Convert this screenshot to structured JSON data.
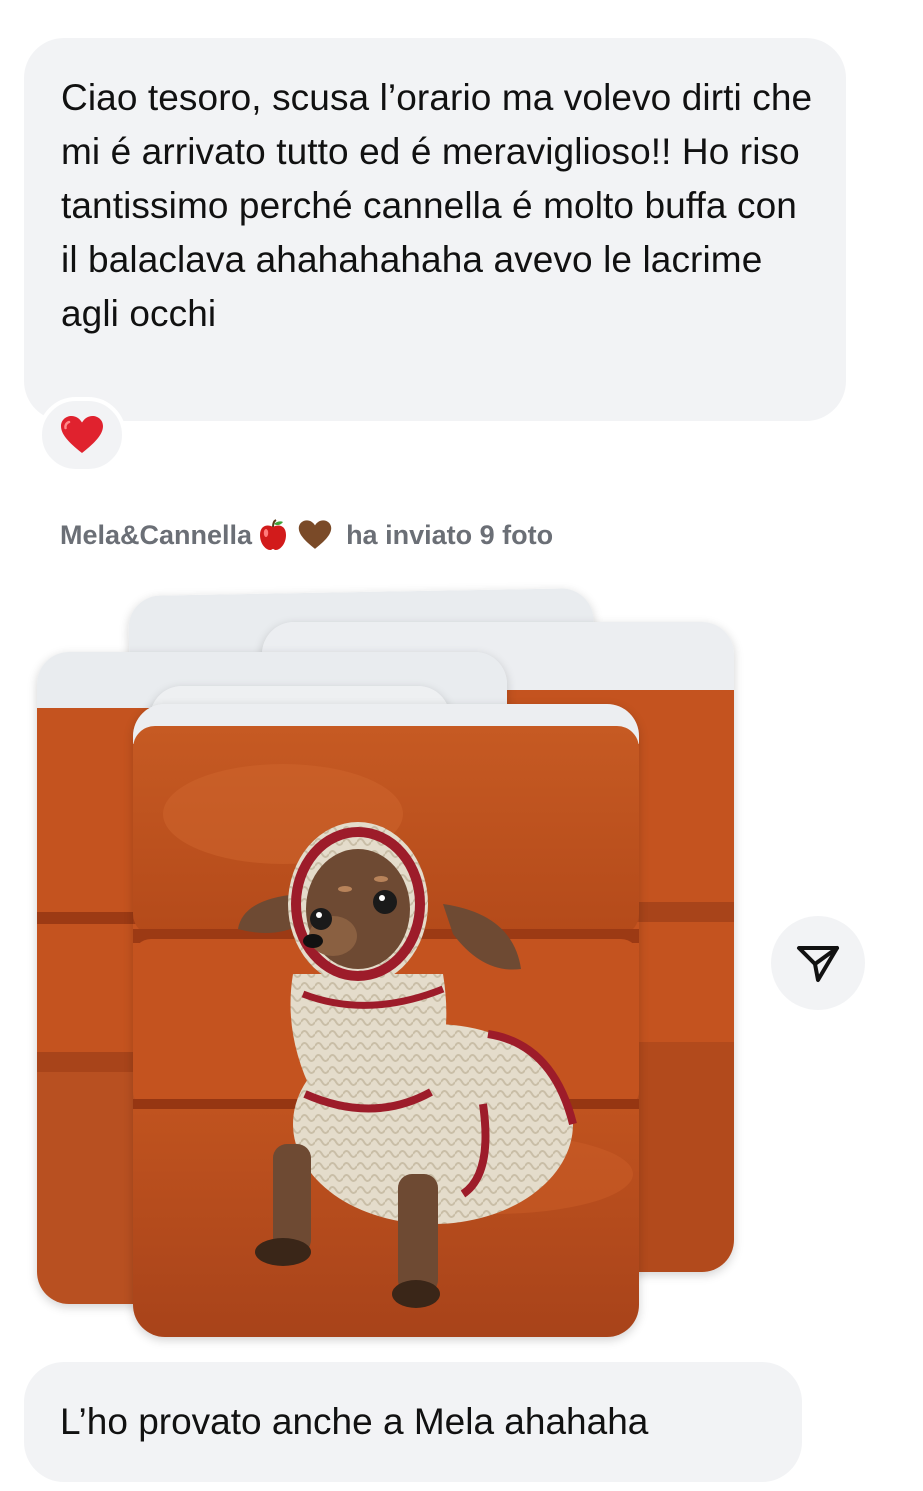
{
  "messages": [
    {
      "text": "Ciao tesoro, scusa l’orario ma volevo dirti che mi é arrivato tutto ed é meraviglioso!! Ho riso tantissimo perché cannella é molto buffa con il balaclava ahahahahaha avevo le lacrime agli occhi"
    },
    {
      "text": "L’ho provato anche a Mela ahahaha"
    }
  ],
  "reaction": {
    "emoji_icon": "red-heart-icon",
    "color": "#e0222e"
  },
  "photo_notice": {
    "sender": "Mela&Cannella",
    "sender_emojis": [
      "apple-icon",
      "brown-heart-icon"
    ],
    "text": "ha inviato 9 foto"
  },
  "photo_stack": {
    "count_visible": 5,
    "main_photo_description": "dachshund-in-crochet-balaclava-and-sweater",
    "colors": {
      "sofa": "#c4531f",
      "sofa_dark": "#9c3a14",
      "wall": "#e9ecef",
      "knit": "#e4dccb",
      "trim": "#9d1c2a",
      "dog": "#6e4a33"
    }
  },
  "share_button": {
    "icon": "share-send-icon"
  }
}
